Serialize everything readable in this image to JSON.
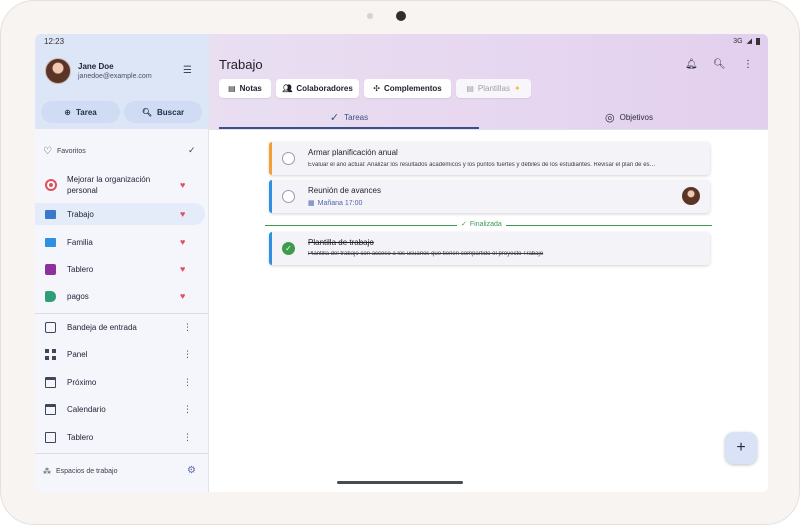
{
  "status": {
    "time": "12:23",
    "network": "3G"
  },
  "user": {
    "name": "Jane Doe",
    "email": "janedoe@example.com"
  },
  "sidebar": {
    "task_button": "Tarea",
    "search_button": "Buscar",
    "favorites_label": "Favoritos",
    "favorites": [
      {
        "label": "Mejorar la organización personal",
        "icon": "target-icon",
        "color": "#e0515f"
      },
      {
        "label": "Trabajo",
        "icon": "folder-icon",
        "color": "#3a78c9",
        "selected": true
      },
      {
        "label": "Familia",
        "icon": "folder-icon",
        "color": "#2f8fe0"
      },
      {
        "label": "Tablero",
        "icon": "board-icon",
        "color": "#8e2f9e"
      },
      {
        "label": "pagos",
        "icon": "tag-icon",
        "color": "#2e9e77"
      }
    ],
    "views": [
      {
        "label": "Bandeja de entrada",
        "icon": "inbox-icon"
      },
      {
        "label": "Panel",
        "icon": "dashboard-icon"
      },
      {
        "label": "Próximo",
        "icon": "calendar-next-icon"
      },
      {
        "label": "Calendario",
        "icon": "calendar-icon"
      },
      {
        "label": "Tablero",
        "icon": "board-outline-icon"
      }
    ],
    "workspaces_label": "Espacios de trabajo"
  },
  "main": {
    "title": "Trabajo",
    "chips": [
      {
        "label": "Notas",
        "icon": "note-icon"
      },
      {
        "label": "Colaboradores",
        "icon": "people-icon"
      },
      {
        "label": "Complementos",
        "icon": "puzzle-icon"
      },
      {
        "label": "Plantillas",
        "icon": "template-icon",
        "disabled": true
      }
    ],
    "tabs": [
      {
        "label": "Tareas",
        "icon": "check-circle-icon",
        "active": true
      },
      {
        "label": "Objetivos",
        "icon": "target-icon"
      }
    ],
    "tasks": [
      {
        "title": "Armar planificación anual",
        "description": "Evaluar el año actual: Analizar los resultados académicos y los puntos fuertes y débiles de los estudiantes. Revisar el plan de es…",
        "bar_color": "#f2a035"
      },
      {
        "title": "Reunión de avances",
        "date": "Mañana 17:00",
        "bar_color": "#2f8fe0"
      }
    ],
    "done_label": "Finalizada",
    "done_tasks": [
      {
        "title": "Plantilla de trabajo",
        "description": "Plantilla del trabajo con acceso a los usuarios que tienen compartido el proyecto Trabajo",
        "bar_color": "#2f8fe0"
      }
    ],
    "fab_label": "+"
  }
}
